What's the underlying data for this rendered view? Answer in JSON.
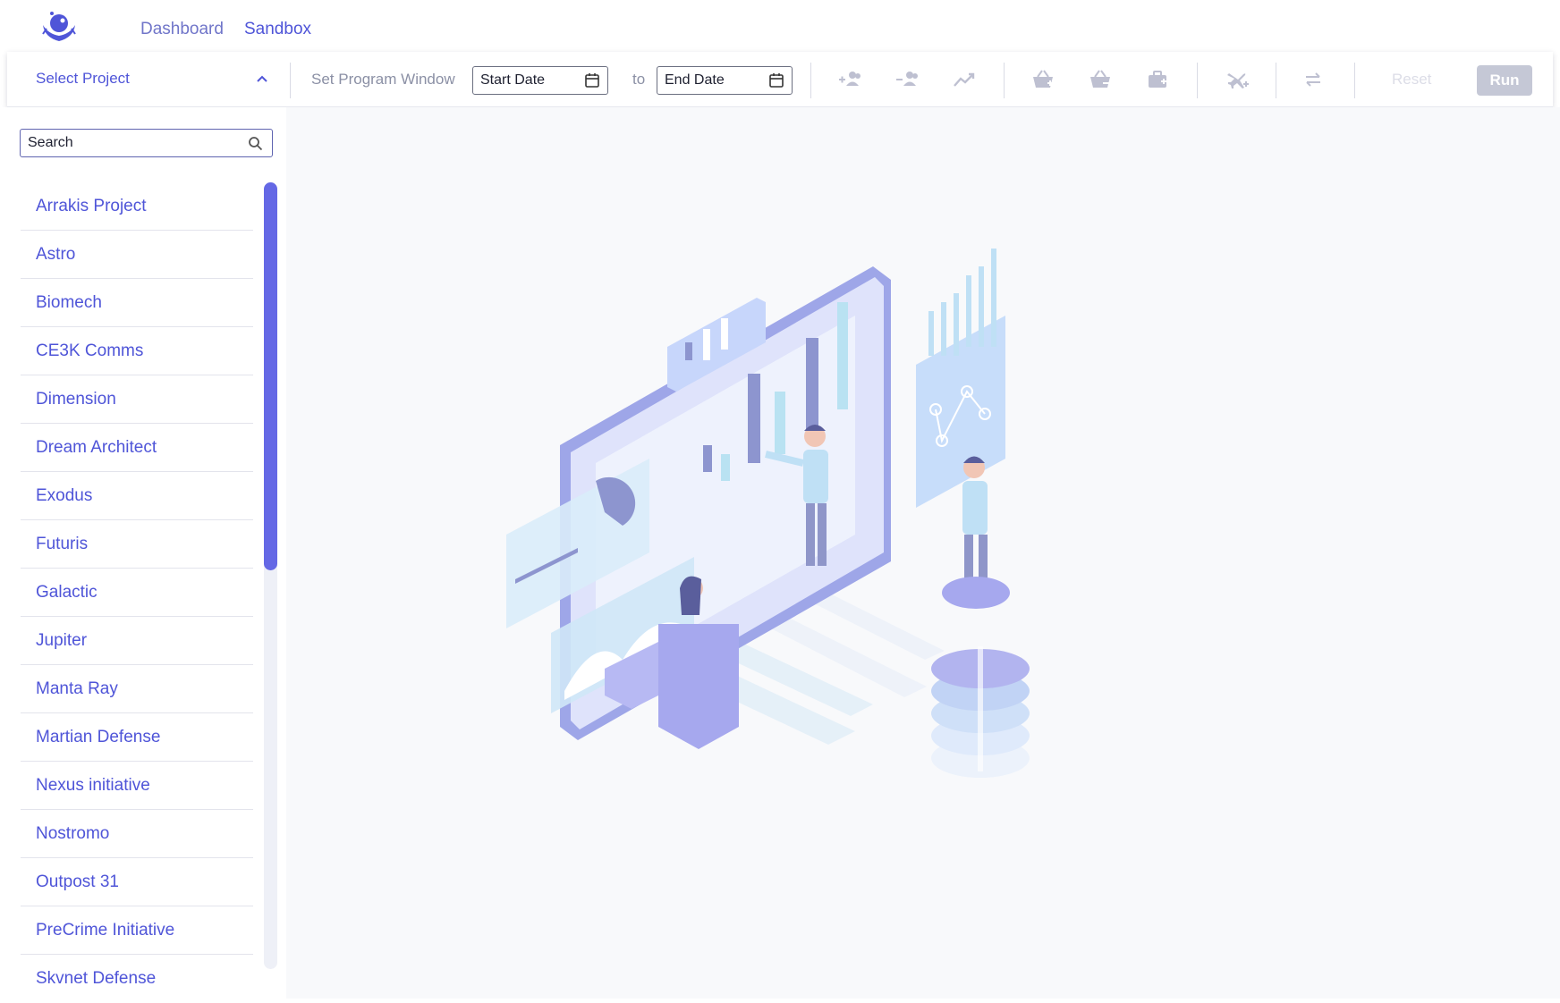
{
  "topnav": {
    "links": [
      {
        "label": "Dashboard",
        "active": false
      },
      {
        "label": "Sandbox",
        "active": true
      }
    ]
  },
  "toolbar": {
    "select_project": "Select Project",
    "window_label": "Set Program Window",
    "start_date_placeholder": "Start Date",
    "to_label": "to",
    "end_date_placeholder": "End Date",
    "reset_label": "Reset",
    "run_label": "Run",
    "icons": [
      "add-person-icon",
      "remove-person-icon",
      "trend-icon",
      "add-basket-icon",
      "remove-basket-icon",
      "briefcase-icon",
      "add-flight-icon",
      "swap-icon"
    ]
  },
  "sidebar": {
    "search_placeholder": "Search",
    "projects": [
      "Arrakis Project",
      "Astro",
      "Biomech",
      "CE3K Comms",
      "Dimension",
      "Dream Architect",
      "Exodus",
      "Futuris",
      "Galactic",
      "Jupiter",
      "Manta Ray",
      "Martian Defense",
      "Nexus initiative",
      "Nostromo",
      "Outpost 31",
      "PreCrime Initiative",
      "Skvnet Defense"
    ]
  },
  "colors": {
    "accent": "#4f55d8",
    "scroll_thumb": "#6468e5",
    "run_disabled": "#c5c8d6"
  }
}
